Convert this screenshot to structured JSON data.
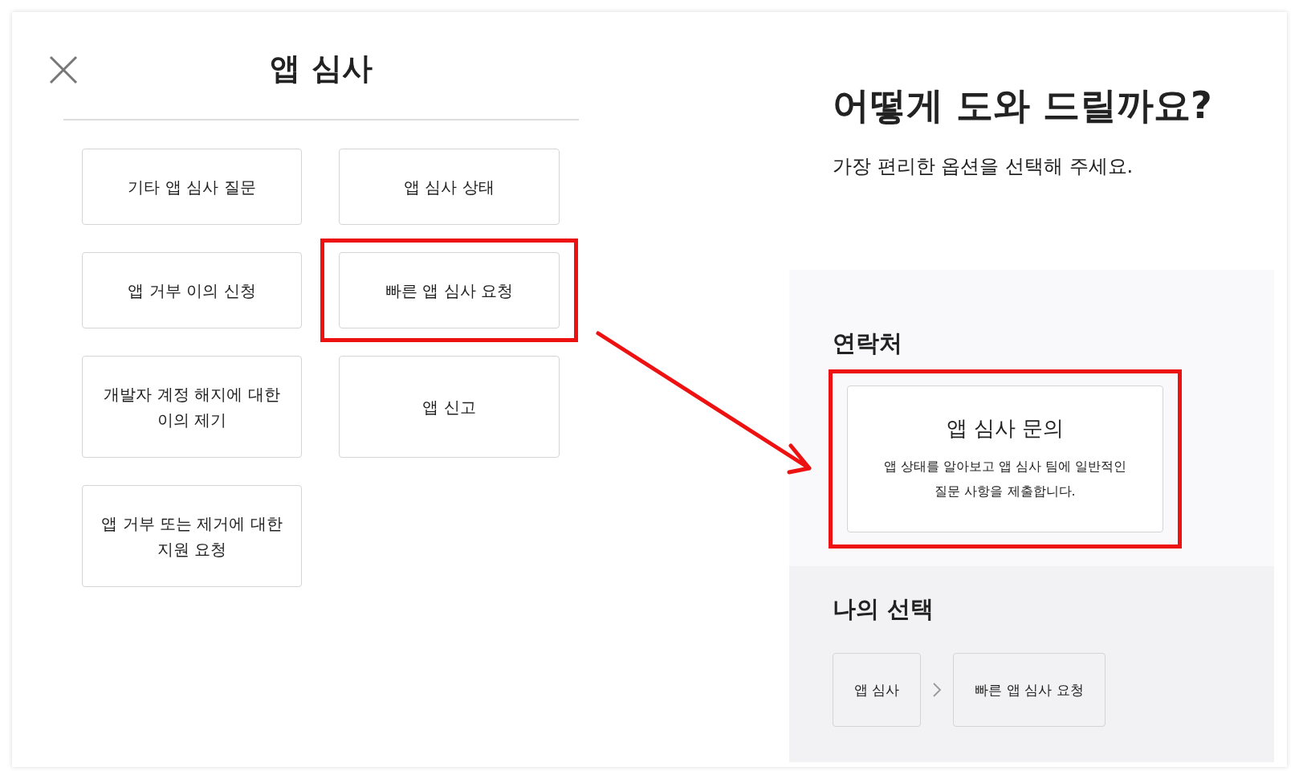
{
  "panel": {
    "title": "앱 심사"
  },
  "options": [
    {
      "label": "기타 앱 심사 질문",
      "highlighted": false
    },
    {
      "label": "앱 심사 상태",
      "highlighted": false
    },
    {
      "label": "앱 거부 이의 신청",
      "highlighted": false
    },
    {
      "label": "빠른 앱 심사 요청",
      "highlighted": true
    },
    {
      "label": "개발자 계정 해지에 대한 이의 제기",
      "highlighted": false
    },
    {
      "label": "앱 신고",
      "highlighted": false
    },
    {
      "label": "앱 거부 또는 제거에 대한 지원 요청",
      "highlighted": false
    }
  ],
  "help": {
    "heading": "어떻게 도와 드릴까요?",
    "subtitle": "가장 편리한 옵션을 선택해 주세요."
  },
  "contact": {
    "heading": "연락처",
    "card": {
      "title": "앱 심사 문의",
      "description": "앱 상태를 알아보고 앱 심사 팀에 일반적인 질문 사항을 제출합니다.",
      "highlighted": true
    }
  },
  "selection": {
    "heading": "나의 선택",
    "path": [
      "앱 심사",
      "빠른 앱 심사 요청"
    ]
  }
}
